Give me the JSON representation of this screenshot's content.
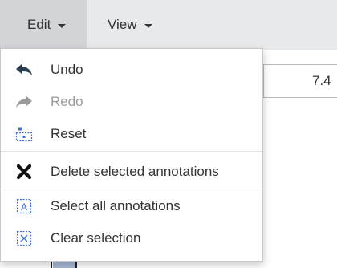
{
  "menubar": {
    "edit_label": "Edit",
    "view_label": "View"
  },
  "background": {
    "partial_value": "7.4"
  },
  "edit_menu": {
    "items": [
      {
        "label": "Undo",
        "icon": "undo-arrow-icon",
        "enabled": true
      },
      {
        "label": "Redo",
        "icon": "redo-arrow-icon",
        "enabled": false
      },
      {
        "label": "Reset",
        "icon": "reset-icon",
        "enabled": true
      },
      {
        "label": "Delete selected annotations",
        "icon": "delete-x-icon",
        "enabled": true
      },
      {
        "label": "Select all annotations",
        "icon": "select-all-icon",
        "enabled": true
      },
      {
        "label": "Clear selection",
        "icon": "clear-selection-icon",
        "enabled": true
      }
    ]
  },
  "colors": {
    "menubar_bg": "#e7e9eb",
    "active_tab_bg": "#d2d4d7",
    "icon_blue": "#3b6fd6",
    "disabled_text": "#9a9a9a"
  }
}
